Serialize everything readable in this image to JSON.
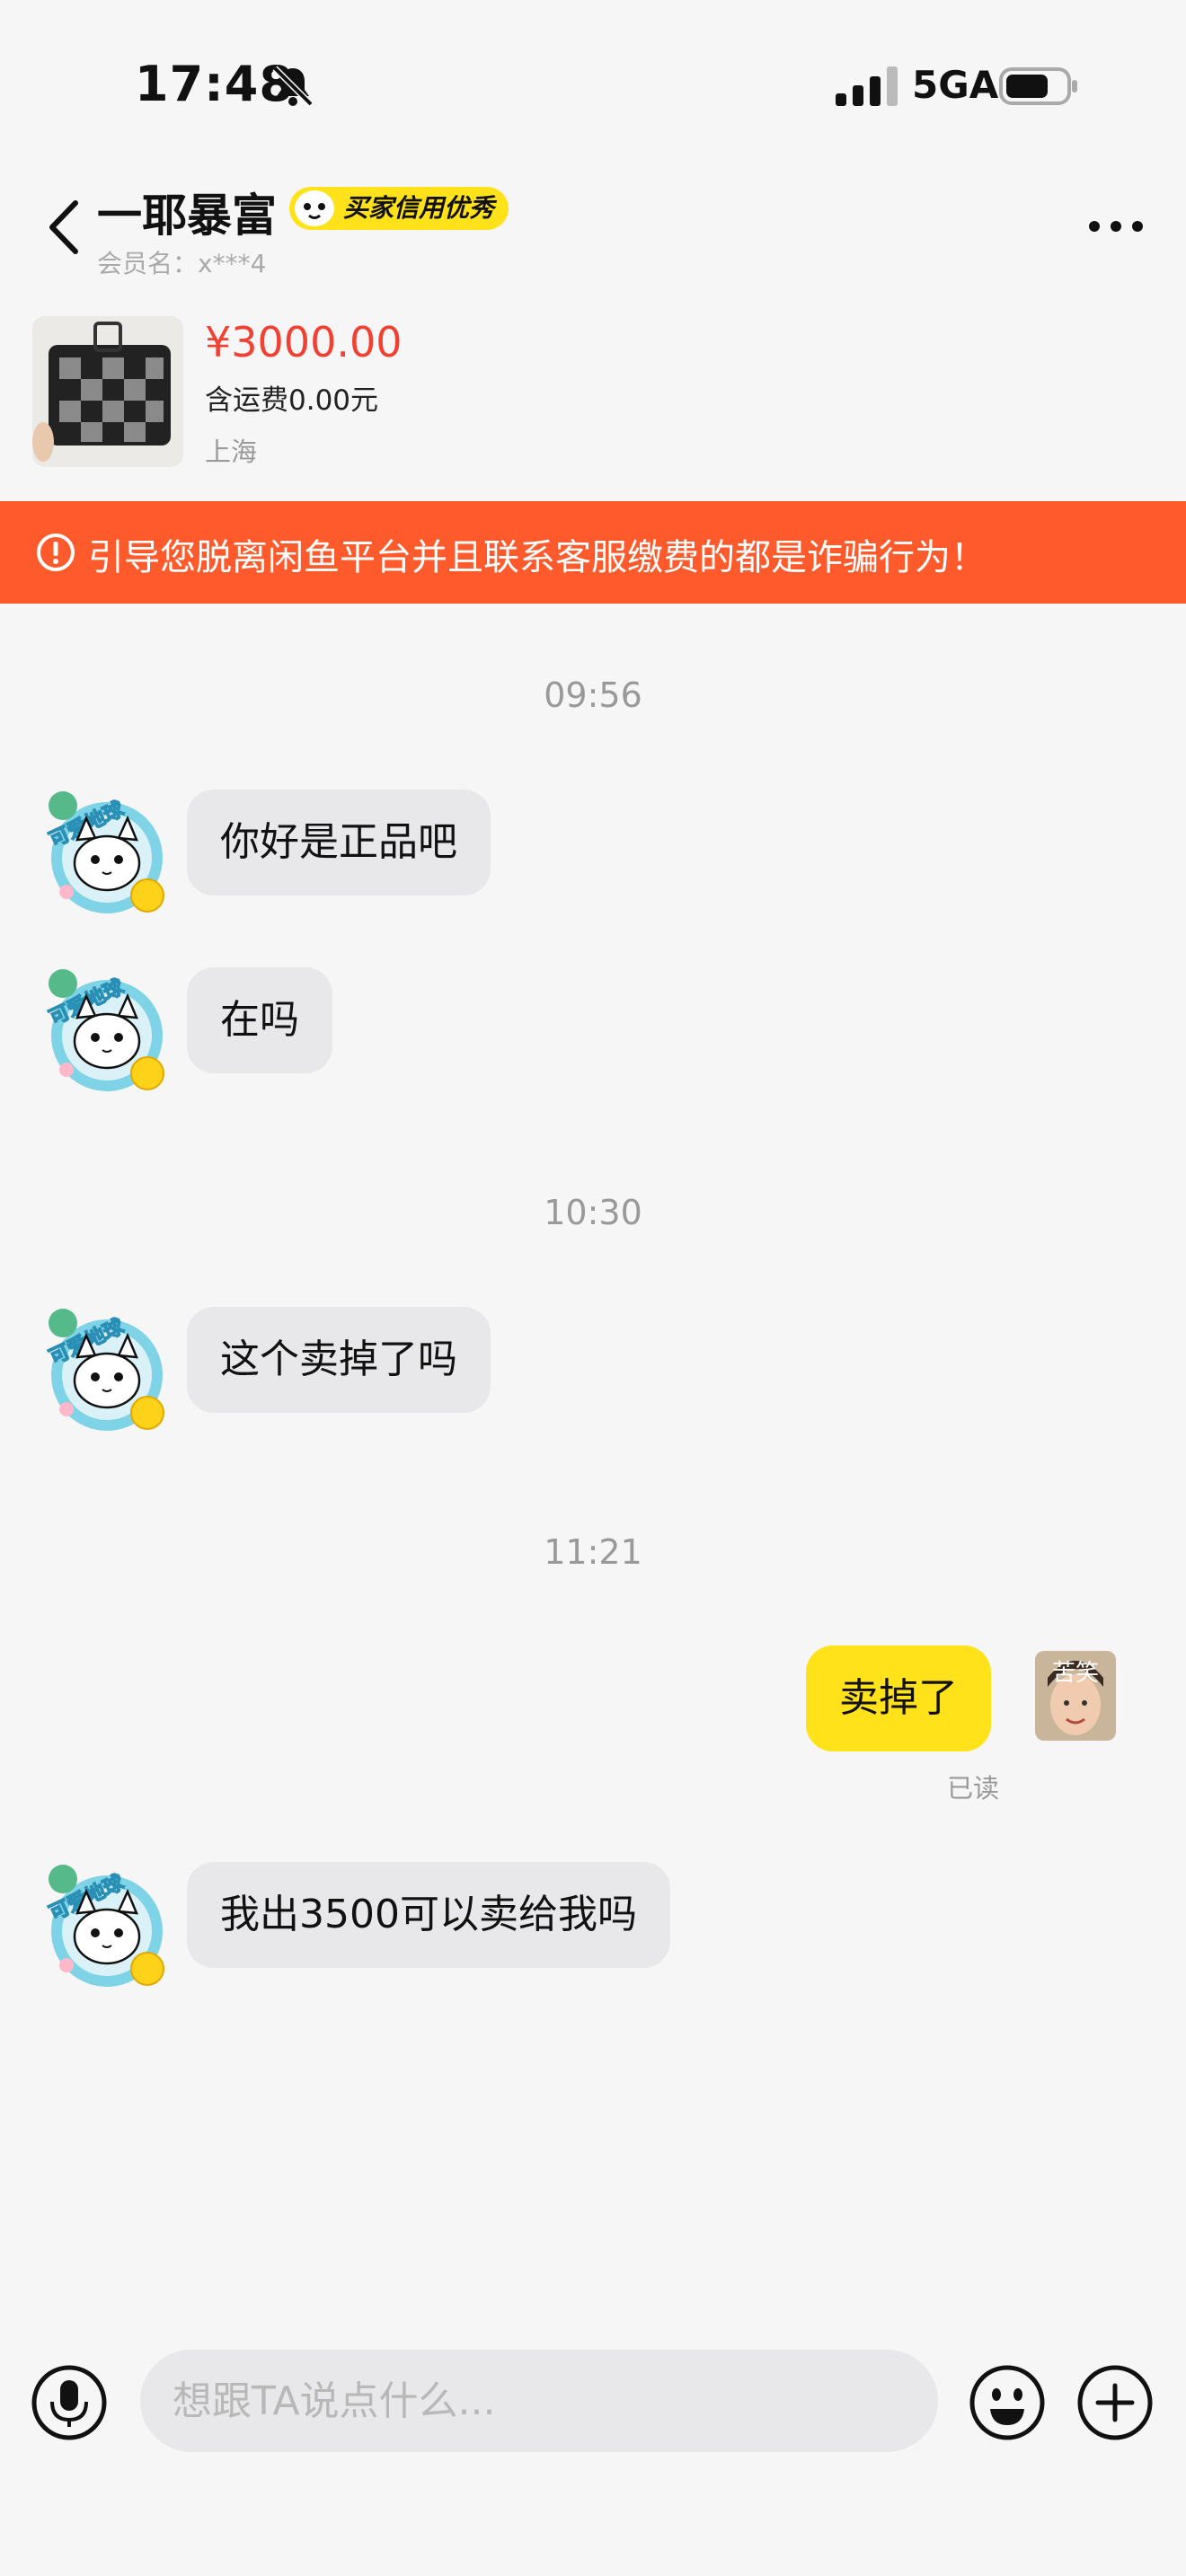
{
  "status": {
    "time": "17:48",
    "network": "5GA",
    "battery_level": 0.72
  },
  "header": {
    "title": "一耶暴富",
    "badge": "买家信用优秀",
    "member": "会员名：x***4"
  },
  "product": {
    "price": "¥3000.00",
    "shipping": "含运费0.00元",
    "location": "上海"
  },
  "warning": "引导您脱离闲鱼平台并且联系客服缴费的都是诈骗行为！",
  "chat": {
    "t1": "09:56",
    "m1": "你好是正品吧",
    "m2": "在吗",
    "t2": "10:30",
    "m3": "这个卖掉了吗",
    "t3": "11:21",
    "m4": "卖掉了",
    "read_status": "已读",
    "my_avatar_text": "苦笑",
    "m5": "我出3500可以卖给我吗"
  },
  "input": {
    "placeholder": "想跟TA说点什么..."
  },
  "icons": [
    "bell-slash-icon",
    "signal-icon",
    "battery-icon",
    "back-chevron-icon",
    "more-icon",
    "alert-icon",
    "microphone-icon",
    "emoji-icon",
    "plus-icon"
  ],
  "colors": {
    "accent_yellow": "#ffe21a",
    "warning_orange": "#ff5a2b",
    "price_red": "#f04133"
  }
}
